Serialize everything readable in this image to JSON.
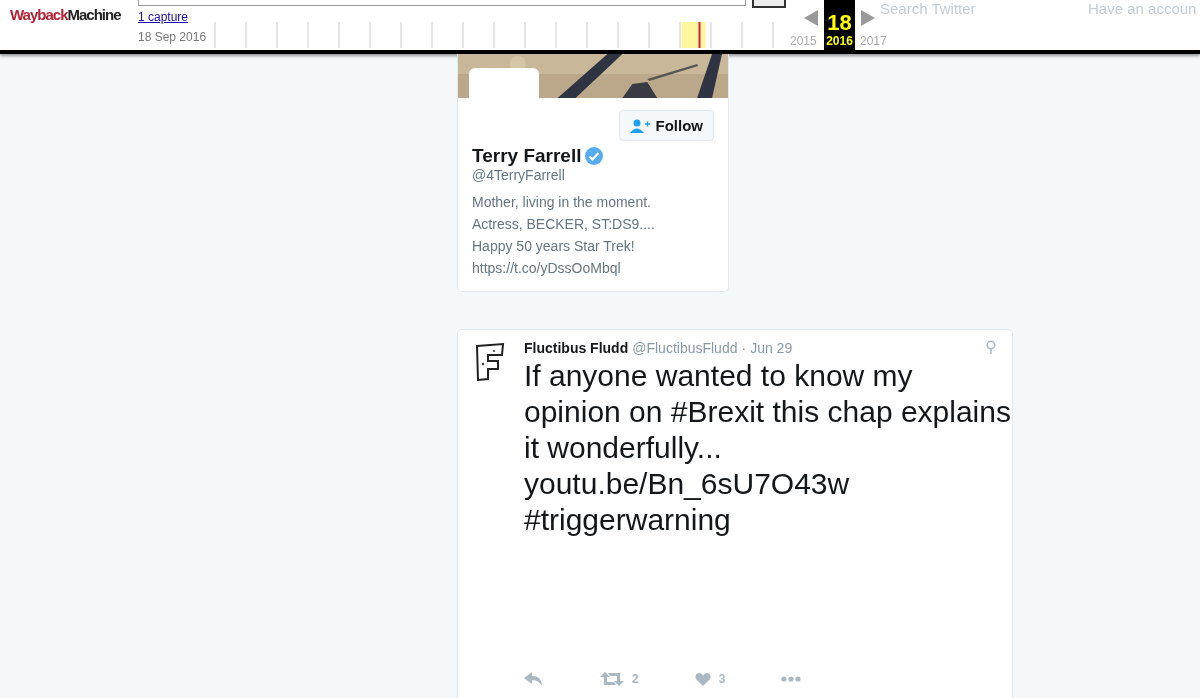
{
  "wayback_toolbar": {
    "logo": {
      "part_1": "Wayback",
      "part_2": "Machine"
    },
    "captures_link": "1 capture",
    "capture_date": "18 Sep 2016",
    "years": [
      {
        "label": "2015",
        "selected": false
      },
      {
        "label": "2016",
        "selected": true,
        "day": "18"
      },
      {
        "label": "2017",
        "selected": false
      }
    ]
  },
  "twitter_nav_behind": {
    "search_placeholder": "Search Twitter",
    "account_prompt": "Have an accoun"
  },
  "profile_card": {
    "follow_button": "Follow",
    "name": "Terry Farrell",
    "verified": true,
    "handle": "@4TerryFarrell",
    "bio_lines": [
      "Mother, living in the moment.",
      "Actress, BECKER, ST:DS9....",
      "Happy 50 years Star Trek!",
      "https://t.co/yDssOoMbql"
    ]
  },
  "tweet": {
    "author": "Fluctibus Fludd",
    "handle": "@FluctibusFludd",
    "separator": "·",
    "date": "Jun 29",
    "text": "If anyone wanted to know my opinion on #Brexit this chap explains it wonderfully... youtu.be/Bn_6sU7O43w #triggerwarning",
    "actions": [
      {
        "kind": "reply"
      },
      {
        "kind": "retweet",
        "count": "2"
      },
      {
        "kind": "like",
        "count": "3"
      },
      {
        "kind": "more"
      }
    ]
  }
}
